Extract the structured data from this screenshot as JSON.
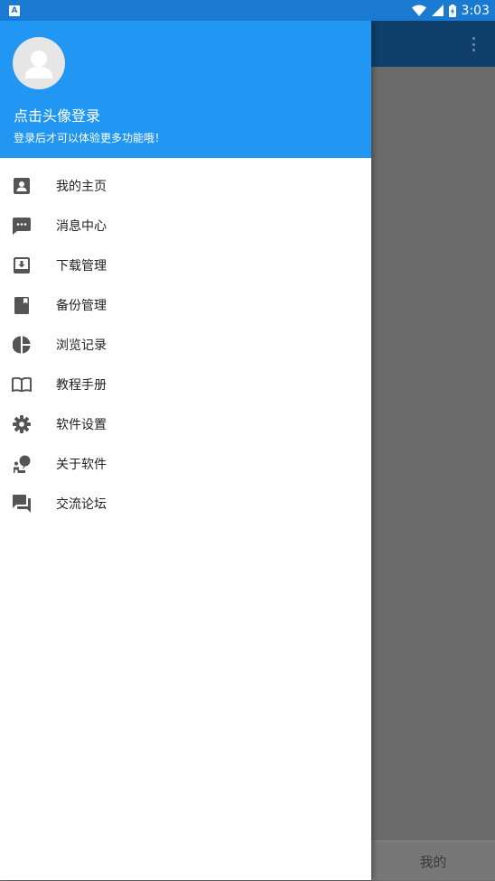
{
  "status_bar": {
    "time": "3:03",
    "app_icon_letter": "A"
  },
  "drawer": {
    "header": {
      "title": "点击头像登录",
      "subtitle": "登录后才可以体验更多功能哦！"
    },
    "items": [
      {
        "label": "我的主页",
        "icon": "account-box-icon"
      },
      {
        "label": "消息中心",
        "icon": "message-icon"
      },
      {
        "label": "下载管理",
        "icon": "download-box-icon"
      },
      {
        "label": "备份管理",
        "icon": "backup-book-icon"
      },
      {
        "label": "浏览记录",
        "icon": "pie-chart-icon"
      },
      {
        "label": "教程手册",
        "icon": "open-book-icon"
      },
      {
        "label": "软件设置",
        "icon": "gear-icon"
      },
      {
        "label": "关于软件",
        "icon": "about-person-icon"
      },
      {
        "label": "交流论坛",
        "icon": "forum-icon"
      }
    ]
  },
  "bottom_nav": {
    "mine_label": "我的"
  },
  "colors": {
    "header_blue": "#2196f3",
    "status_blue": "#1a7ad1",
    "app_bar_dark": "#0e406b",
    "scrim_gray": "#6b6b6b",
    "icon_gray": "#555555"
  }
}
